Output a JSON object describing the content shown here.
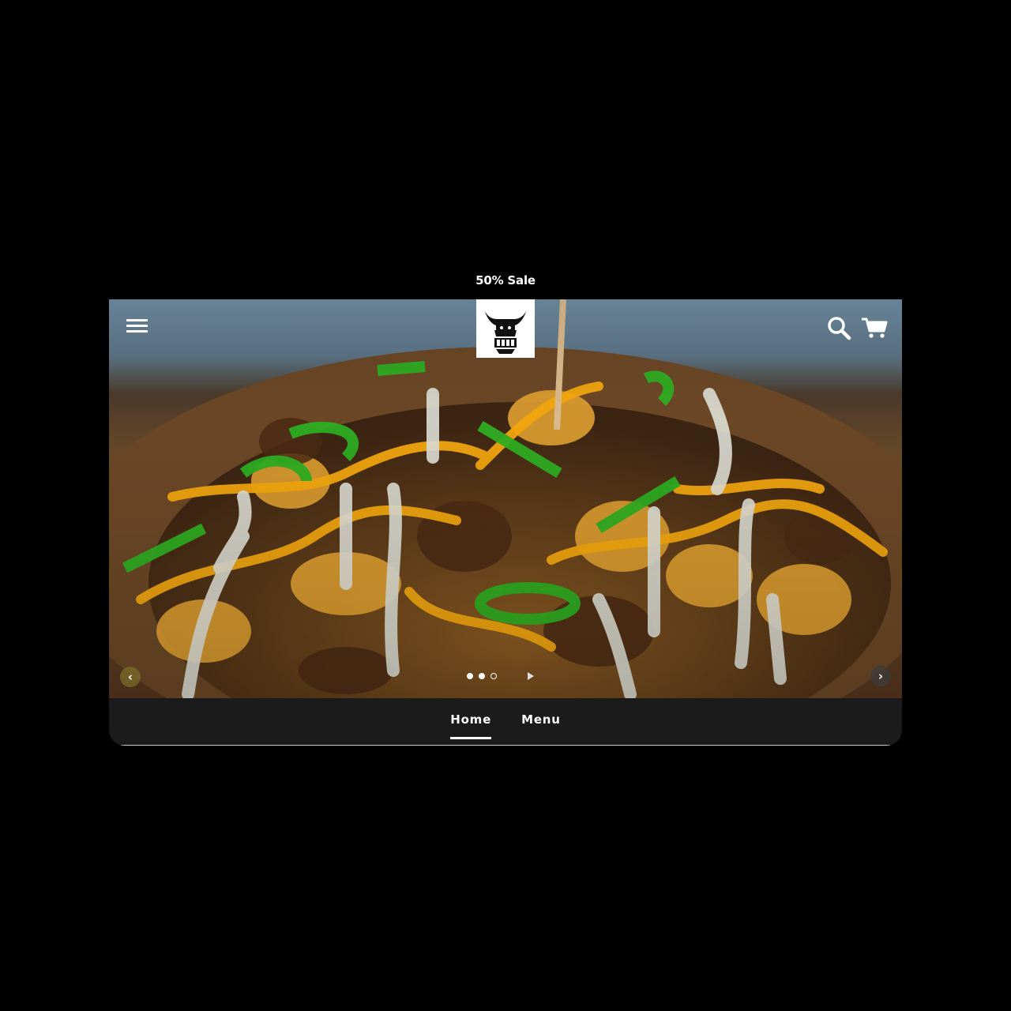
{
  "announcement": {
    "text": "50% Sale"
  },
  "header": {
    "menu_icon": "hamburger-menu-icon",
    "logo_icon": "bull-head-logo-icon",
    "search_icon": "search-icon",
    "cart_icon": "shopping-cart-icon"
  },
  "slideshow": {
    "prev_label": "‹",
    "next_label": "›",
    "slide_count": 3,
    "active_slide": 2,
    "play_icon": "play-icon"
  },
  "nav": {
    "items": [
      {
        "label": "Home",
        "active": true
      },
      {
        "label": "Menu",
        "active": false
      }
    ]
  },
  "colors": {
    "background": "#000000",
    "nav_background": "#1b1b1b",
    "text": "#ffffff"
  }
}
